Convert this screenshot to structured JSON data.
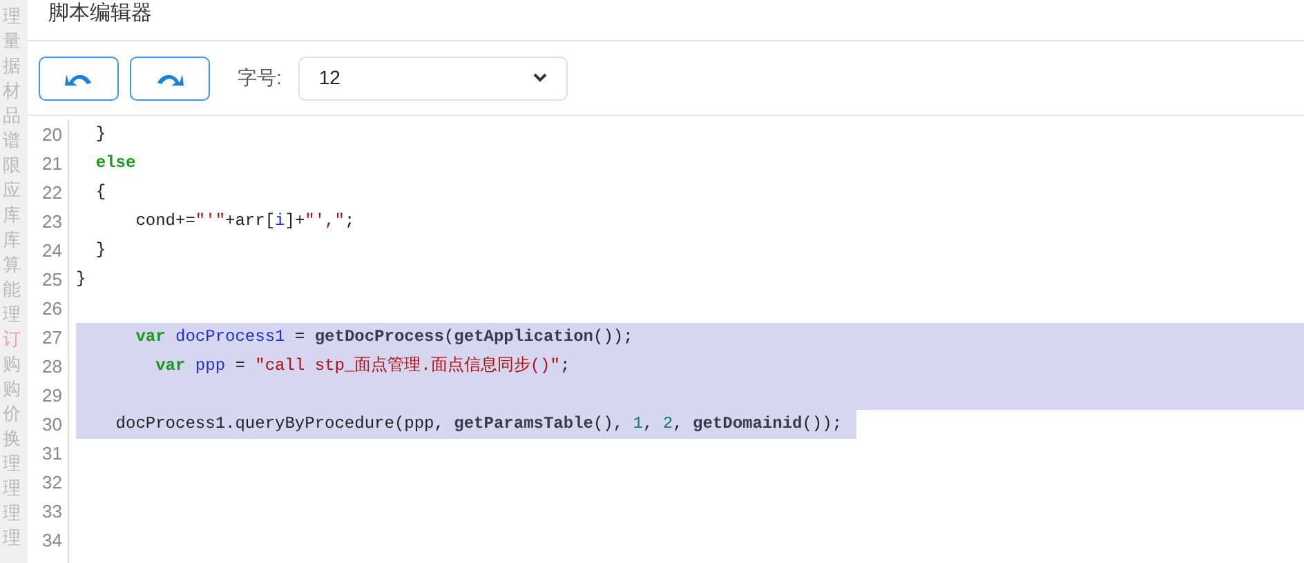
{
  "background_sidebar": {
    "items": [
      {
        "label": "理",
        "selected": false
      },
      {
        "label": "量",
        "selected": false
      },
      {
        "label": "据",
        "selected": false
      },
      {
        "label": "材",
        "selected": false
      },
      {
        "label": "品",
        "selected": false
      },
      {
        "label": "谱",
        "selected": false
      },
      {
        "label": "限",
        "selected": false
      },
      {
        "label": "应",
        "selected": false
      },
      {
        "label": "库",
        "selected": false
      },
      {
        "label": "库",
        "selected": false
      },
      {
        "label": "算",
        "selected": false
      },
      {
        "label": "能",
        "selected": false
      },
      {
        "label": "理",
        "selected": false
      },
      {
        "label": "订",
        "selected": true
      },
      {
        "label": "购",
        "selected": false
      },
      {
        "label": "购",
        "selected": false
      },
      {
        "label": "价",
        "selected": false
      },
      {
        "label": "换",
        "selected": false
      },
      {
        "label": "理",
        "selected": false
      },
      {
        "label": "理",
        "selected": false
      },
      {
        "label": "理",
        "selected": false
      },
      {
        "label": "理",
        "selected": false
      }
    ]
  },
  "dialog": {
    "title": "脚本编辑器"
  },
  "toolbar": {
    "font_size_label": "字号:",
    "font_size": "12"
  },
  "editor": {
    "lines": [
      {
        "number": "20",
        "selected": false,
        "tokens": [
          {
            "text": "  }",
            "kind": "plain"
          }
        ]
      },
      {
        "number": "21",
        "selected": false,
        "tokens": [
          {
            "text": "  else",
            "kind": "keyword"
          }
        ]
      },
      {
        "number": "22",
        "selected": false,
        "tokens": [
          {
            "text": "  {",
            "kind": "plain"
          }
        ]
      },
      {
        "number": "23",
        "selected": false,
        "tokens": [
          {
            "text": "      cond+=",
            "kind": "plain"
          },
          {
            "text": "\"'\"",
            "kind": "string"
          },
          {
            "text": "+arr[",
            "kind": "plain"
          },
          {
            "text": "i",
            "kind": "ident"
          },
          {
            "text": "]+",
            "kind": "plain"
          },
          {
            "text": "\"',\"",
            "kind": "string"
          },
          {
            "text": ";",
            "kind": "plain"
          }
        ]
      },
      {
        "number": "24",
        "selected": false,
        "tokens": [
          {
            "text": "  }",
            "kind": "plain"
          }
        ]
      },
      {
        "number": "25",
        "selected": false,
        "tokens": [
          {
            "text": "}",
            "kind": "plain"
          }
        ]
      },
      {
        "number": "26",
        "selected": false
      },
      {
        "number": "27",
        "selected": true,
        "tokens": [
          {
            "text": "      var",
            "kind": "keyword"
          },
          {
            "text": " docProcess1",
            "kind": "ident"
          },
          {
            "text": " = ",
            "kind": "plain"
          },
          {
            "text": "getDocProcess",
            "kind": "func"
          },
          {
            "text": "(",
            "kind": "plain"
          },
          {
            "text": "getApplication",
            "kind": "func"
          },
          {
            "text": "());",
            "kind": "plain"
          }
        ]
      },
      {
        "number": "28",
        "selected": true,
        "tokens": [
          {
            "text": "        var",
            "kind": "keyword"
          },
          {
            "text": " ppp",
            "kind": "ident"
          },
          {
            "text": " = ",
            "kind": "plain"
          },
          {
            "text": "\"call stp_面点管理.面点信息同步()\"",
            "kind": "string"
          },
          {
            "text": ";",
            "kind": "plain"
          }
        ]
      },
      {
        "number": "29",
        "selected": true
      },
      {
        "number": "30",
        "selected": true,
        "tokens": [
          {
            "text": "    docProcess1.queryByProcedure(ppp, ",
            "kind": "plain"
          },
          {
            "text": "getParamsTable",
            "kind": "func"
          },
          {
            "text": "(), ",
            "kind": "plain"
          },
          {
            "text": "1",
            "kind": "number"
          },
          {
            "text": ", ",
            "kind": "plain"
          },
          {
            "text": "2",
            "kind": "number"
          },
          {
            "text": ", ",
            "kind": "plain"
          },
          {
            "text": "getDomainid",
            "kind": "func"
          },
          {
            "text": "());",
            "kind": "plain"
          }
        ]
      },
      {
        "number": "31",
        "selected": false
      },
      {
        "number": "32",
        "selected": false
      },
      {
        "number": "33",
        "selected": false
      },
      {
        "number": "34",
        "selected": false
      }
    ]
  }
}
